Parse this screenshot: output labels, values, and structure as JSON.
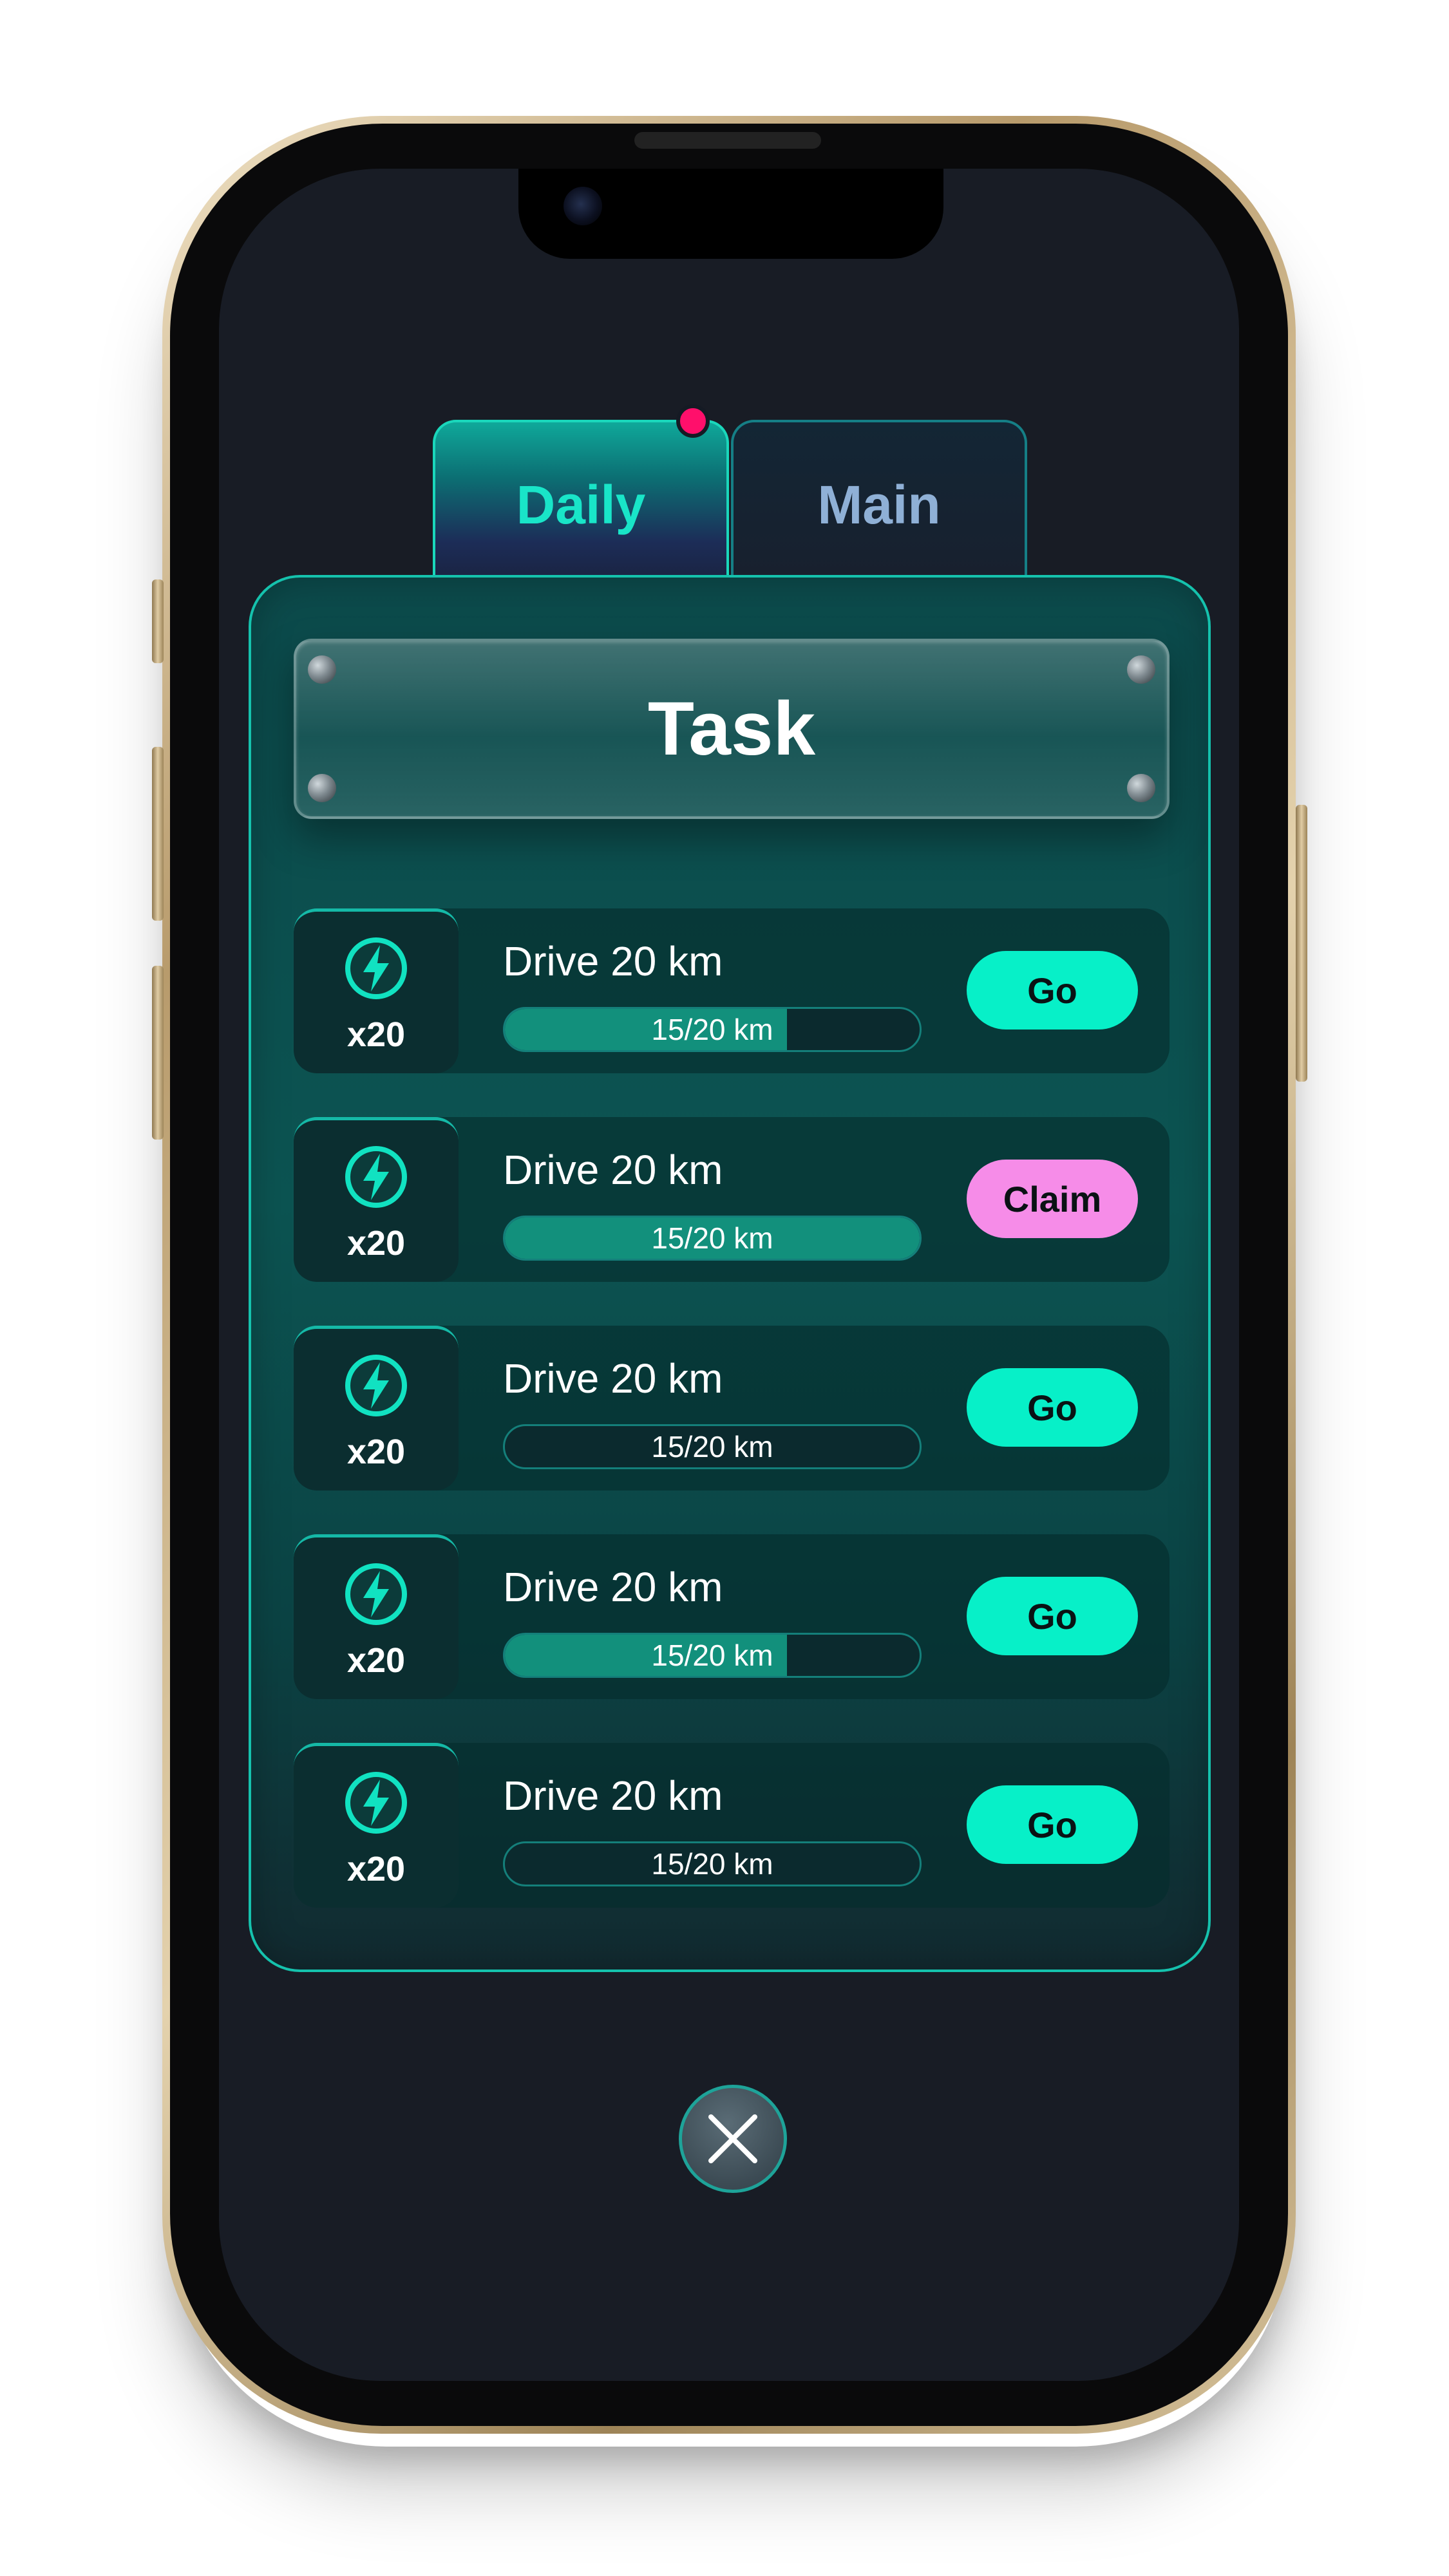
{
  "tabs": [
    {
      "label": "Daily",
      "active": true,
      "has_notification": true
    },
    {
      "label": "Main",
      "active": false,
      "has_notification": false
    }
  ],
  "panel": {
    "title": "Task"
  },
  "tasks": [
    {
      "icon": "lightning-icon",
      "reward": "x20",
      "title": "Drive 20 km",
      "progress_text": "15/20 km",
      "progress": 0.68,
      "action": "Go",
      "action_type": "go"
    },
    {
      "icon": "lightning-icon",
      "reward": "x20",
      "title": "Drive 20 km",
      "progress_text": "15/20 km",
      "progress": 1.0,
      "action": "Claim",
      "action_type": "claim"
    },
    {
      "icon": "lightning-icon",
      "reward": "x20",
      "title": "Drive 20 km",
      "progress_text": "15/20 km",
      "progress": 0.0,
      "action": "Go",
      "action_type": "go"
    },
    {
      "icon": "lightning-icon",
      "reward": "x20",
      "title": "Drive 20 km",
      "progress_text": "15/20 km",
      "progress": 0.68,
      "action": "Go",
      "action_type": "go"
    },
    {
      "icon": "lightning-icon",
      "reward": "x20",
      "title": "Drive 20 km",
      "progress_text": "15/20 km",
      "progress": 0.0,
      "action": "Go",
      "action_type": "go"
    }
  ],
  "close": {
    "icon": "close-icon"
  },
  "colors": {
    "accent": "#07f0c8",
    "claim": "#f68ce8",
    "notification": "#ff0f6b",
    "background": "#181c25",
    "panel": "#0c5452"
  }
}
